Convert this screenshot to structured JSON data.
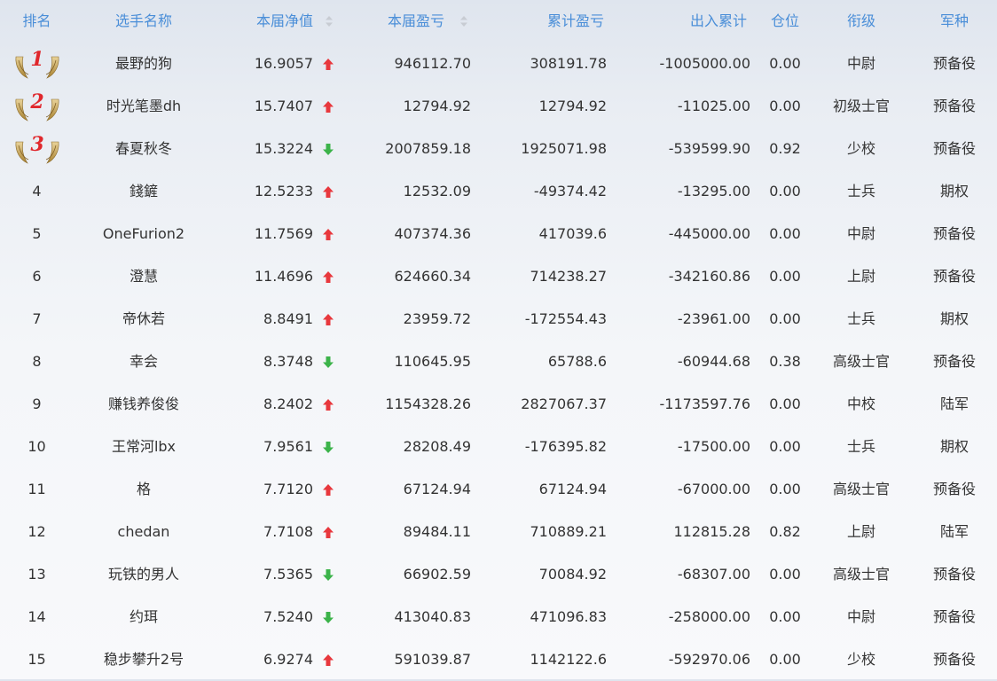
{
  "headers": {
    "rank": "排名",
    "name": "选手名称",
    "nav": "本届净值",
    "pnl": "本届盈亏",
    "cum": "累计盈亏",
    "flow": "出入累计",
    "pos": "仓位",
    "grade": "衔级",
    "type": "军种"
  },
  "colors": {
    "header": "#4a8ed8",
    "up": "#e8383d",
    "down": "#3cb34a",
    "medal_num": "#e0272c"
  },
  "rows": [
    {
      "rank": "1",
      "medal": true,
      "name": "最野的狗",
      "nav": "16.9057",
      "trend": "up",
      "pnl": "946112.70",
      "cum": "308191.78",
      "flow": "-1005000.00",
      "pos": "0.00",
      "grade": "中尉",
      "type": "预备役"
    },
    {
      "rank": "2",
      "medal": true,
      "name": "时光笔墨dh",
      "nav": "15.7407",
      "trend": "up",
      "pnl": "12794.92",
      "cum": "12794.92",
      "flow": "-11025.00",
      "pos": "0.00",
      "grade": "初级士官",
      "type": "预备役"
    },
    {
      "rank": "3",
      "medal": true,
      "name": "春夏秋冬",
      "nav": "15.3224",
      "trend": "down",
      "pnl": "2007859.18",
      "cum": "1925071.98",
      "flow": "-539599.90",
      "pos": "0.92",
      "grade": "少校",
      "type": "预备役"
    },
    {
      "rank": "4",
      "medal": false,
      "name": "錢鏟",
      "nav": "12.5233",
      "trend": "up",
      "pnl": "12532.09",
      "cum": "-49374.42",
      "flow": "-13295.00",
      "pos": "0.00",
      "grade": "士兵",
      "type": "期权"
    },
    {
      "rank": "5",
      "medal": false,
      "name": "OneFurion2",
      "nav": "11.7569",
      "trend": "up",
      "pnl": "407374.36",
      "cum": "417039.6",
      "flow": "-445000.00",
      "pos": "0.00",
      "grade": "中尉",
      "type": "预备役"
    },
    {
      "rank": "6",
      "medal": false,
      "name": "澄慧",
      "nav": "11.4696",
      "trend": "up",
      "pnl": "624660.34",
      "cum": "714238.27",
      "flow": "-342160.86",
      "pos": "0.00",
      "grade": "上尉",
      "type": "预备役"
    },
    {
      "rank": "7",
      "medal": false,
      "name": "帝休若",
      "nav": "8.8491",
      "trend": "up",
      "pnl": "23959.72",
      "cum": "-172554.43",
      "flow": "-23961.00",
      "pos": "0.00",
      "grade": "士兵",
      "type": "期权"
    },
    {
      "rank": "8",
      "medal": false,
      "name": "幸会",
      "nav": "8.3748",
      "trend": "down",
      "pnl": "110645.95",
      "cum": "65788.6",
      "flow": "-60944.68",
      "pos": "0.38",
      "grade": "高级士官",
      "type": "预备役"
    },
    {
      "rank": "9",
      "medal": false,
      "name": "赚钱养俊俊",
      "nav": "8.2402",
      "trend": "up",
      "pnl": "1154328.26",
      "cum": "2827067.37",
      "flow": "-1173597.76",
      "pos": "0.00",
      "grade": "中校",
      "type": "陆军"
    },
    {
      "rank": "10",
      "medal": false,
      "name": "王常河lbx",
      "nav": "7.9561",
      "trend": "down",
      "pnl": "28208.49",
      "cum": "-176395.82",
      "flow": "-17500.00",
      "pos": "0.00",
      "grade": "士兵",
      "type": "期权"
    },
    {
      "rank": "11",
      "medal": false,
      "name": "格",
      "nav": "7.7120",
      "trend": "up",
      "pnl": "67124.94",
      "cum": "67124.94",
      "flow": "-67000.00",
      "pos": "0.00",
      "grade": "高级士官",
      "type": "预备役"
    },
    {
      "rank": "12",
      "medal": false,
      "name": "chedan",
      "nav": "7.7108",
      "trend": "up",
      "pnl": "89484.11",
      "cum": "710889.21",
      "flow": "112815.28",
      "pos": "0.82",
      "grade": "上尉",
      "type": "陆军"
    },
    {
      "rank": "13",
      "medal": false,
      "name": "玩铁的男人",
      "nav": "7.5365",
      "trend": "down",
      "pnl": "66902.59",
      "cum": "70084.92",
      "flow": "-68307.00",
      "pos": "0.00",
      "grade": "高级士官",
      "type": "预备役"
    },
    {
      "rank": "14",
      "medal": false,
      "name": "约珥",
      "nav": "7.5240",
      "trend": "down",
      "pnl": "413040.83",
      "cum": "471096.83",
      "flow": "-258000.00",
      "pos": "0.00",
      "grade": "中尉",
      "type": "预备役"
    },
    {
      "rank": "15",
      "medal": false,
      "name": "稳步攀升2号",
      "nav": "6.9274",
      "trend": "up",
      "pnl": "591039.87",
      "cum": "1142122.6",
      "flow": "-592970.06",
      "pos": "0.00",
      "grade": "少校",
      "type": "预备役"
    }
  ]
}
